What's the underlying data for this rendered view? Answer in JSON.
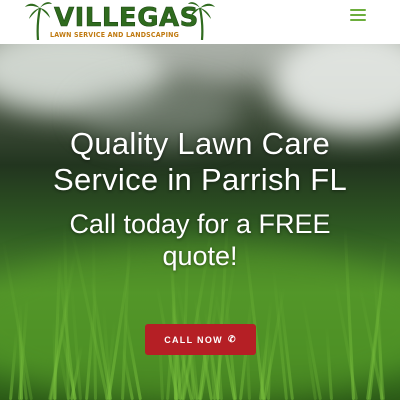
{
  "header": {
    "logo_word": "VILLEGAS",
    "logo_tagline": "LAWN SERVICE AND LANDSCAPING"
  },
  "hero": {
    "headline_line1": "Quality Lawn Care",
    "headline_line2": "Service in Parrish FL",
    "subhead_line1": "Call today for a FREE",
    "subhead_line2": "quote!"
  },
  "cta": {
    "label": "CALL NOW",
    "icon": "phone-icon"
  },
  "colors": {
    "brand_green": "#2f6b1e",
    "brand_orange": "#c07a10",
    "menu_green": "#6cae3c",
    "cta_red": "#b51f25"
  }
}
